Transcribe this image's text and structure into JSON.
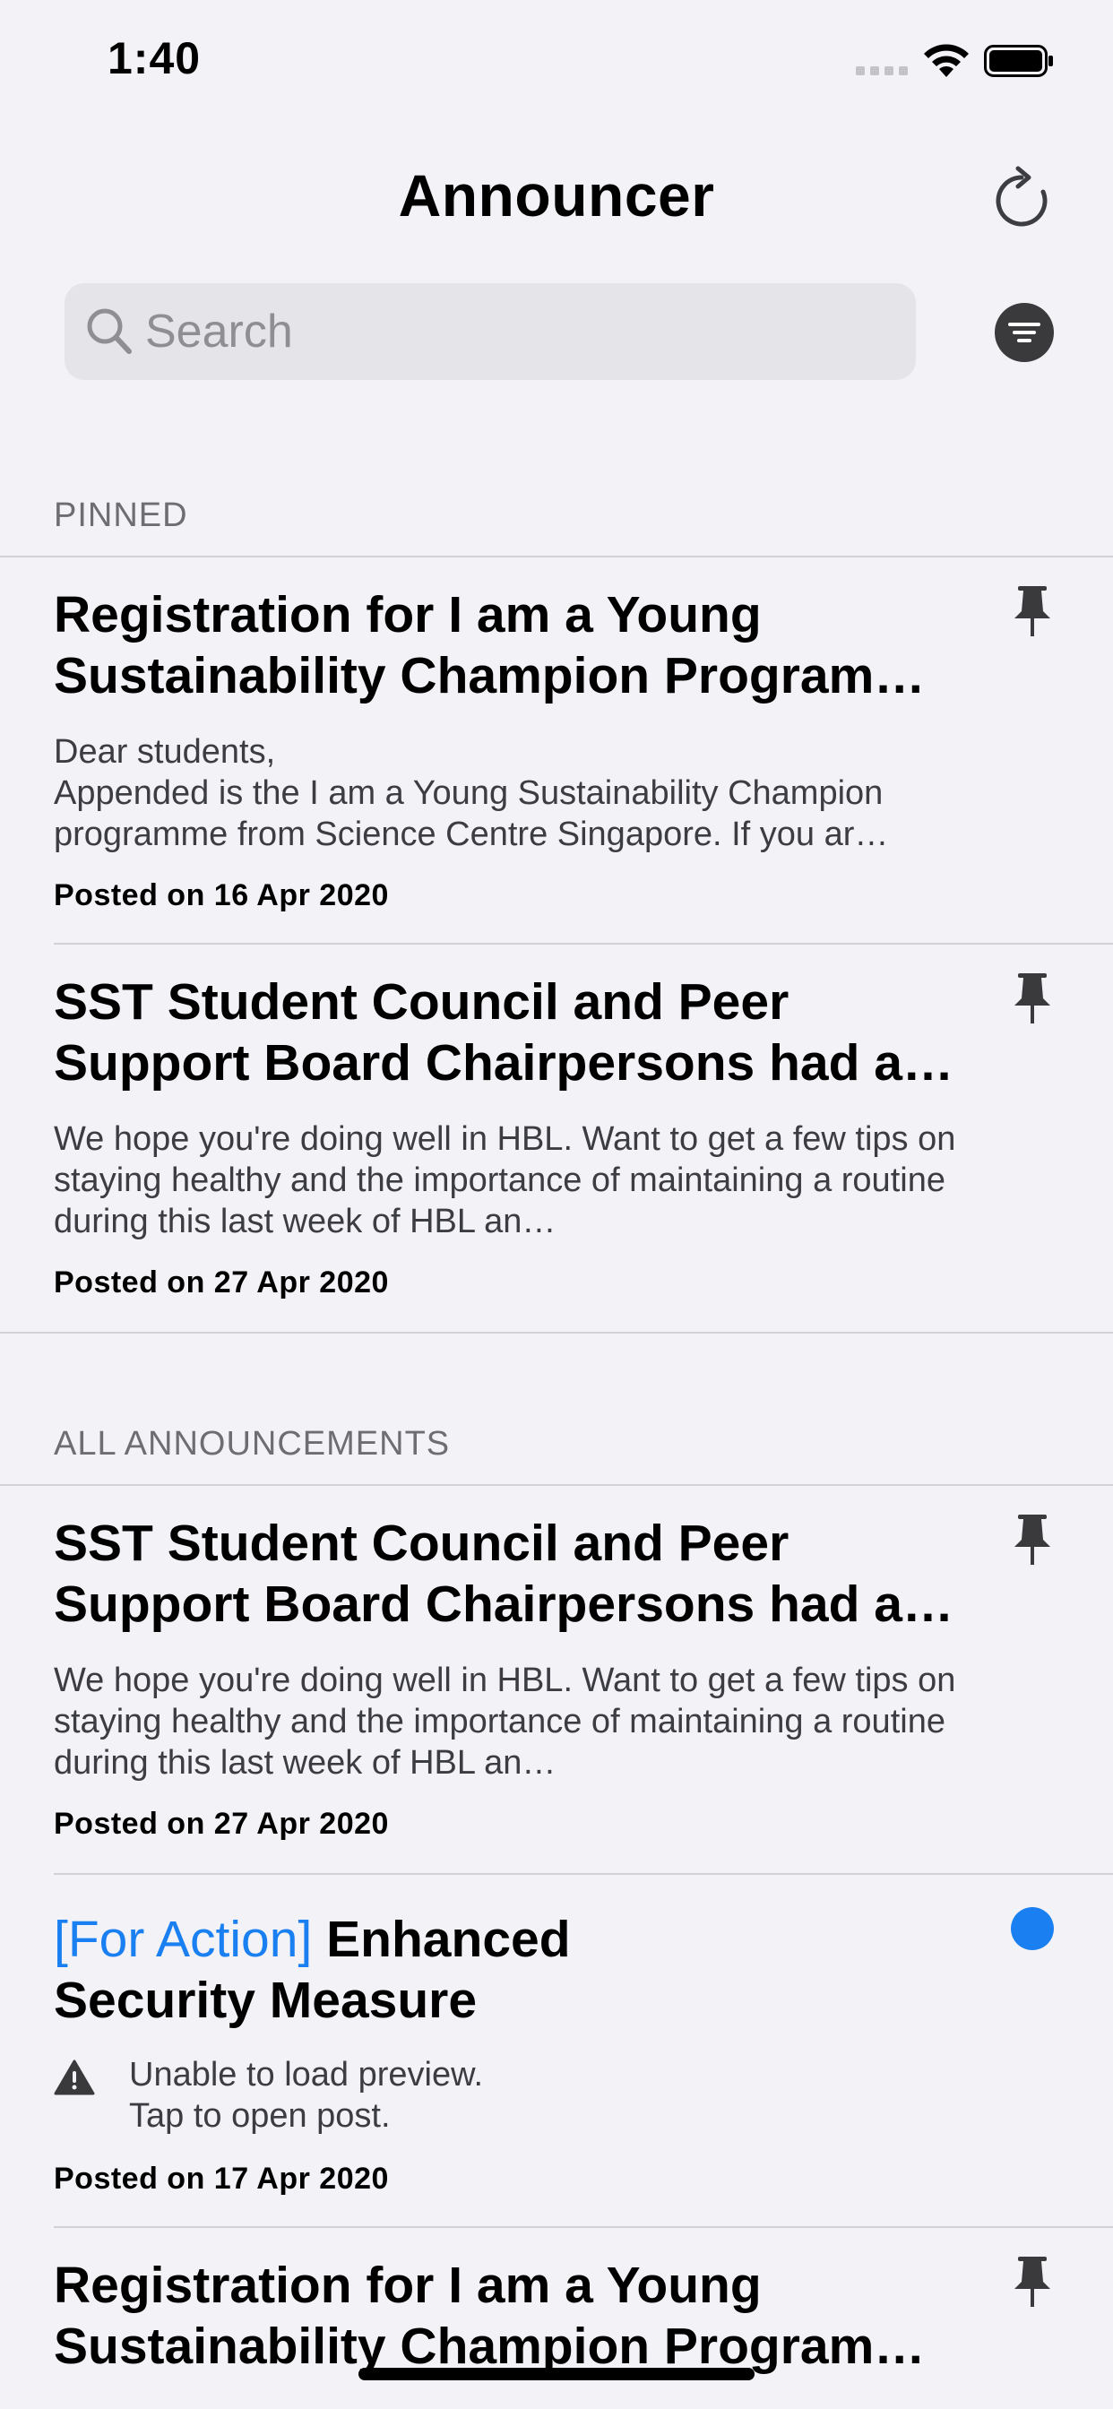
{
  "status_bar": {
    "time": "1:40"
  },
  "header": {
    "title": "Announcer"
  },
  "search": {
    "placeholder": "Search"
  },
  "sections": {
    "pinned": {
      "label": "PINNED",
      "items": [
        {
          "title": "Registration for I am a Young Sustainability Champion Program…",
          "preview": "Dear students,\nAppended is the I am a Young Sustainability Champion programme from Science Centre Singapore. If you ar…",
          "date": "Posted on 16 Apr 2020"
        },
        {
          "title": "SST Student Council and Peer Support Board Chairpersons had a…",
          "preview": "We hope you're doing well in HBL. Want to get a few tips on staying healthy and the importance of maintaining a routine during this last week of HBL an…",
          "date": "Posted on 27 Apr 2020"
        }
      ]
    },
    "all": {
      "label": "ALL ANNOUNCEMENTS",
      "items": [
        {
          "title": "SST Student Council and Peer Support Board Chairpersons had a…",
          "preview": "We hope you're doing well in HBL. Want to get a few tips on staying healthy and the importance of maintaining a routine during this last week of HBL an…",
          "date": "Posted on 27 Apr 2020"
        },
        {
          "tag": "[For Action]",
          "title": "Enhanced Security Measure",
          "preview": "Unable to load preview.\nTap to open post.",
          "date": "Posted on 17 Apr 2020"
        },
        {
          "title": "Registration for I am a Young Sustainability Champion Program…"
        }
      ]
    }
  },
  "colors": {
    "accent": "#1a7ff0",
    "background": "#f2f2f7",
    "separator": "#d1d1d6",
    "secondary_text": "#6d6d72"
  },
  "icons": [
    "wifi-icon",
    "battery-icon",
    "refresh-icon",
    "search-icon",
    "filter-icon",
    "pin-icon",
    "warning-icon",
    "unread-dot"
  ]
}
